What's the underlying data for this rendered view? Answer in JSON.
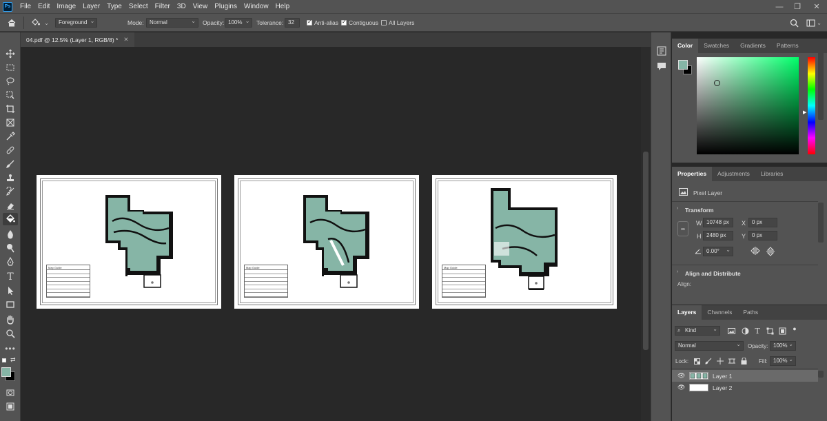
{
  "menu": [
    "File",
    "Edit",
    "Image",
    "Layer",
    "Type",
    "Select",
    "Filter",
    "3D",
    "View",
    "Plugins",
    "Window",
    "Help"
  ],
  "app_logo": "Ps",
  "window_controls": {
    "minimize": "—",
    "restore": "❐",
    "close": "✕"
  },
  "options": {
    "fill_source": "Foreground",
    "mode_label": "Mode:",
    "mode_value": "Normal",
    "opacity_label": "Opacity:",
    "opacity_value": "100%",
    "tolerance_label": "Tolerance:",
    "tolerance_value": "32",
    "anti_alias_label": "Anti-alias",
    "anti_alias_checked": true,
    "contiguous_label": "Contiguous",
    "contiguous_checked": true,
    "all_layers_label": "All Layers",
    "all_layers_checked": false
  },
  "document_tab": {
    "title": "04.pdf @ 12.5% (Layer 1, RGB/8) *",
    "close": "✕"
  },
  "color_panel": {
    "tabs": [
      "Color",
      "Swatches",
      "Gradients",
      "Patterns"
    ],
    "active_tab": "Color",
    "foreground_color": "#86b5a6",
    "background_color": "#000000",
    "picker_hue": "#00ff6a"
  },
  "properties_panel": {
    "tabs": [
      "Properties",
      "Adjustments",
      "Libraries"
    ],
    "active_tab": "Properties",
    "layer_type": "Pixel Layer",
    "transform_title": "Transform",
    "w_label": "W",
    "w_value": "10748 px",
    "h_label": "H",
    "h_value": "2480 px",
    "x_label": "X",
    "x_value": "0 px",
    "y_label": "Y",
    "y_value": "0 px",
    "angle_value": "0.00°",
    "align_title": "Align and Distribute",
    "align_label": "Align:"
  },
  "layers_panel": {
    "tabs": [
      "Layers",
      "Channels",
      "Paths"
    ],
    "active_tab": "Layers",
    "filter_kind": "Kind",
    "blend_mode": "Normal",
    "opacity_label": "Opacity:",
    "opacity_value": "100%",
    "lock_label": "Lock:",
    "fill_label": "Fill:",
    "fill_value": "100%",
    "layers": [
      {
        "name": "Layer 1",
        "selected": true
      },
      {
        "name": "Layer 2",
        "selected": false
      }
    ]
  },
  "sheets": [
    {
      "legend_title": "Map Guide"
    },
    {
      "legend_title": "Map Guide"
    },
    {
      "legend_title": "Map Guide"
    }
  ],
  "plan_colors": {
    "floor": "#86b5a6",
    "walls": "#111111"
  }
}
